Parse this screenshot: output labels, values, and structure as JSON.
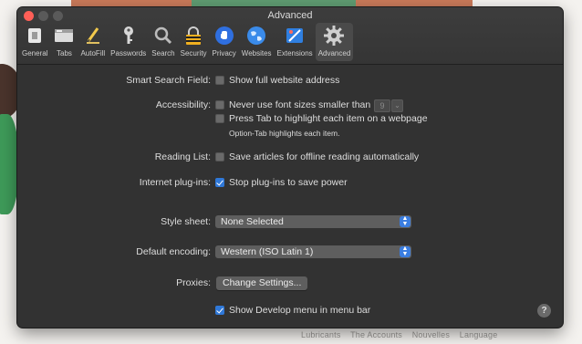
{
  "window": {
    "title": "Advanced"
  },
  "toolbar": {
    "items": [
      {
        "label": "General",
        "icon": "general-icon"
      },
      {
        "label": "Tabs",
        "icon": "tabs-icon"
      },
      {
        "label": "AutoFill",
        "icon": "autofill-icon"
      },
      {
        "label": "Passwords",
        "icon": "key-icon"
      },
      {
        "label": "Search",
        "icon": "search-icon"
      },
      {
        "label": "Security",
        "icon": "lock-icon"
      },
      {
        "label": "Privacy",
        "icon": "hand-icon"
      },
      {
        "label": "Websites",
        "icon": "globe-icon"
      },
      {
        "label": "Extensions",
        "icon": "puzzle-icon"
      },
      {
        "label": "Advanced",
        "icon": "gear-icon"
      }
    ],
    "selected": "Advanced"
  },
  "settings": {
    "smart_search_label": "Smart Search Field:",
    "show_full_address": {
      "label": "Show full website address",
      "checked": false
    },
    "accessibility_label": "Accessibility:",
    "never_font_smaller": {
      "label": "Never use font sizes smaller than",
      "checked": false,
      "value": "9"
    },
    "press_tab": {
      "label": "Press Tab to highlight each item on a webpage",
      "checked": false
    },
    "option_tab_note": "Option-Tab highlights each item.",
    "reading_list_label": "Reading List:",
    "save_offline": {
      "label": "Save articles for offline reading automatically",
      "checked": false
    },
    "plugins_label": "Internet plug-ins:",
    "stop_plugins": {
      "label": "Stop plug-ins to save power",
      "checked": true
    },
    "style_sheet_label": "Style sheet:",
    "style_sheet_value": "None Selected",
    "encoding_label": "Default encoding:",
    "encoding_value": "Western (ISO Latin 1)",
    "proxies_label": "Proxies:",
    "proxies_button": "Change Settings...",
    "develop_menu": {
      "label": "Show Develop menu in menu bar",
      "checked": true
    },
    "help": "?"
  },
  "background": {
    "footer_links": [
      "Lubricants",
      "The Accounts",
      "Nouvelles",
      "Language"
    ]
  },
  "colors": {
    "accent": "#2f78d8",
    "close": "#ff5f57"
  }
}
